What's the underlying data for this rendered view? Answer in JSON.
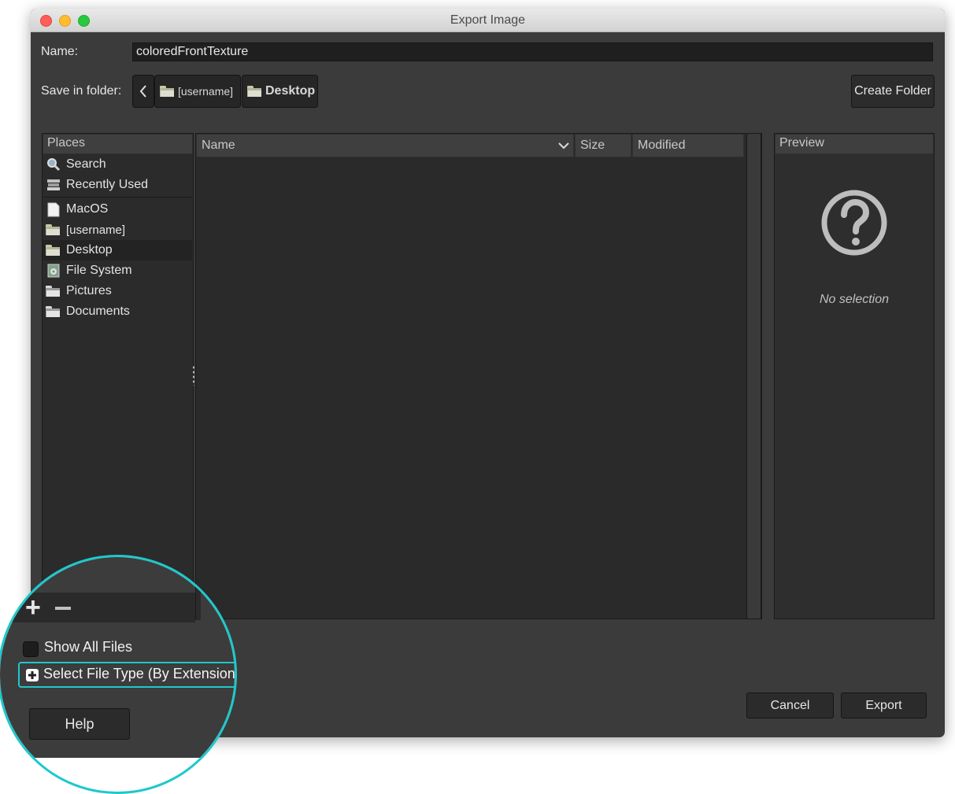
{
  "window": {
    "title": "Export Image"
  },
  "name_label": "Name:",
  "name_value": "coloredFrontTexture",
  "folder_label": "Save in folder:",
  "breadcrumb": {
    "items": [
      "[username]",
      "Desktop"
    ]
  },
  "create_folder_label": "Create Folder",
  "places": {
    "header": "Places",
    "items": [
      {
        "label": "Search",
        "icon": "search-icon"
      },
      {
        "label": "Recently Used",
        "icon": "recent-icon"
      },
      {
        "label": "MacOS",
        "icon": "drive-icon"
      },
      {
        "label": "[username]",
        "icon": "folder-icon"
      },
      {
        "label": "Desktop",
        "icon": "folder-icon",
        "selected": true
      },
      {
        "label": "File System",
        "icon": "filesystem-icon"
      },
      {
        "label": "Pictures",
        "icon": "folder-icon"
      },
      {
        "label": "Documents",
        "icon": "folder-icon"
      }
    ],
    "add_symbol": "+",
    "remove_symbol": "−"
  },
  "file_list": {
    "columns": [
      "Name",
      "Size",
      "Modified"
    ]
  },
  "preview": {
    "header": "Preview",
    "empty_text": "No selection",
    "icon": "question-icon"
  },
  "show_all_files_label": "Show All Files",
  "select_type_label": "Select File Type (By Extension",
  "buttons": {
    "help": "Help",
    "cancel": "Cancel",
    "export": "Export"
  },
  "colors": {
    "highlight": "#1fc8cc",
    "window_bg": "#3b3b3b"
  }
}
